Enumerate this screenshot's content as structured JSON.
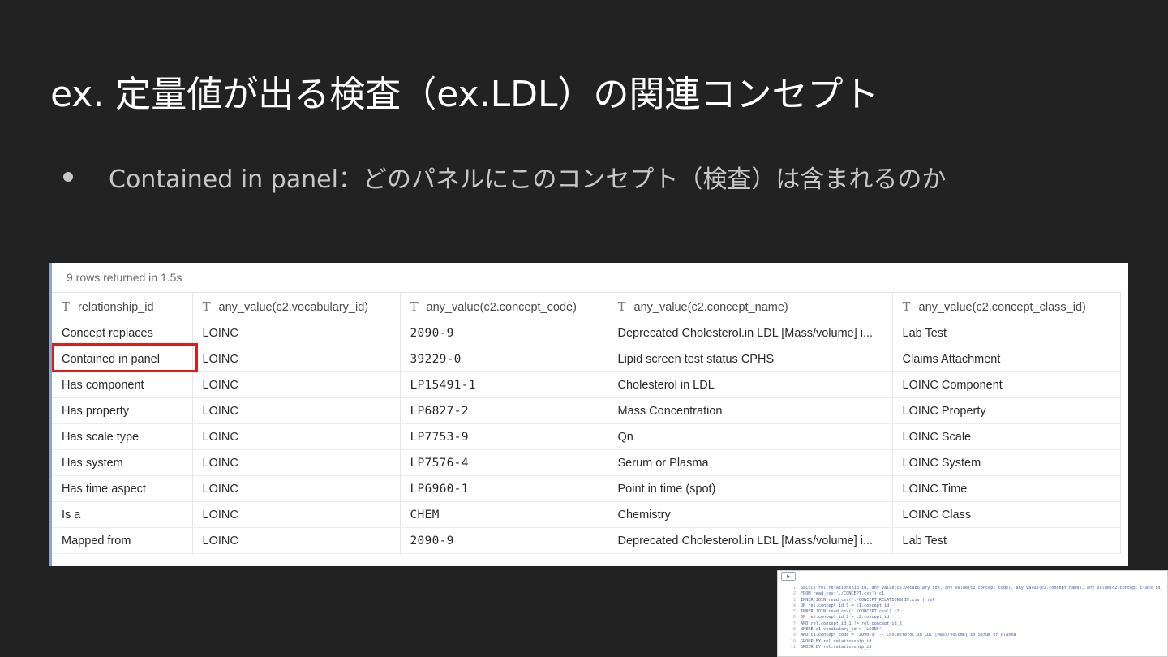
{
  "slide": {
    "title": "ex. 定量値が出る検査（ex.LDL）の関連コンセプト",
    "bullet": "Contained in panel：どのパネルにこのコンセプト（検査）は含まれるのか"
  },
  "result": {
    "status": "9 rows returned in 1.5s",
    "type_icon": "T",
    "columns": [
      "relationship_id",
      "any_value(c2.vocabulary_id)",
      "any_value(c2.concept_code)",
      "any_value(c2.concept_name)",
      "any_value(c2.concept_class_id)"
    ],
    "rows": [
      [
        "Concept replaces",
        "LOINC",
        "2090-9",
        "Deprecated Cholesterol.in LDL [Mass/volume] i...",
        "Lab Test"
      ],
      [
        "Contained in panel",
        "LOINC",
        "39229-0",
        "Lipid screen test status CPHS",
        "Claims Attachment"
      ],
      [
        "Has component",
        "LOINC",
        "LP15491-1",
        "Cholesterol in LDL",
        "LOINC Component"
      ],
      [
        "Has property",
        "LOINC",
        "LP6827-2",
        "Mass Concentration",
        "LOINC Property"
      ],
      [
        "Has scale type",
        "LOINC",
        "LP7753-9",
        "Qn",
        "LOINC Scale"
      ],
      [
        "Has system",
        "LOINC",
        "LP7576-4",
        "Serum or Plasma",
        "LOINC System"
      ],
      [
        "Has time aspect",
        "LOINC",
        "LP6960-1",
        "Point in time (spot)",
        "LOINC Time"
      ],
      [
        "Is a",
        "LOINC",
        "CHEM",
        "Chemistry",
        "LOINC Class"
      ],
      [
        "Mapped from",
        "LOINC",
        "2090-9",
        "Deprecated Cholesterol.in LDL [Mass/volume] i...",
        "Lab Test"
      ]
    ],
    "highlight_color": "#e01b1b"
  },
  "sql": {
    "run_icon": "play-icon",
    "lines": [
      [
        "1",
        "SELECT rel.relationship_id, any_value(c2.vocabulary_id), any_value(c2.concept_code), any_value(c2.concept_name), any_value(c2.concept_class_id)"
      ],
      [
        "2",
        "FROM read_csv('./CONCEPT.csv') c1"
      ],
      [
        "3",
        "INNER JOIN read_csv('./CONCEPT_RELATIONSHIP.csv') rel"
      ],
      [
        "4",
        "  ON rel.concept_id_1 = c1.concept_id"
      ],
      [
        "5",
        "INNER JOIN read_csv('./CONCEPT.csv') c2"
      ],
      [
        "6",
        "  ON rel.concept_id_2 = c2.concept_id"
      ],
      [
        "7",
        "    AND rel.concept_id_1 != rel.concept_id_2"
      ],
      [
        "8",
        "WHERE c1.vocabulary_id = 'LOINC'"
      ],
      [
        "9",
        "  AND c1.concept_code = '2090-9' -- Cholesterol in LDL [Mass/volume] in Serum or Plasma"
      ],
      [
        "10",
        "GROUP BY rel.relationship_id"
      ],
      [
        "11",
        "ORDER BY rel.relationship_id"
      ]
    ]
  }
}
